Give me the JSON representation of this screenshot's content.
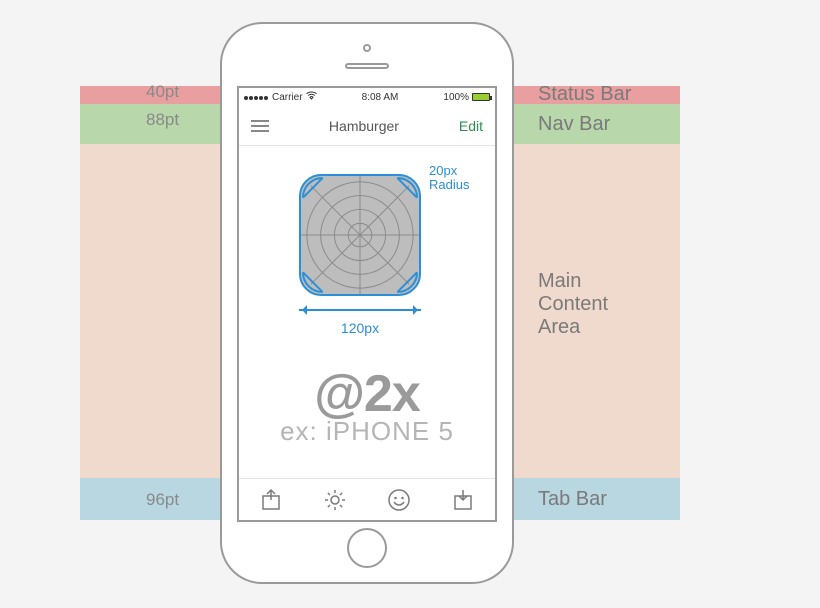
{
  "annotations": {
    "statusBarPt": "40pt",
    "navBarPt": "88pt",
    "tabBarPt": "96pt"
  },
  "bands": {
    "status": "Status Bar",
    "nav": "Nav Bar",
    "main": "Main\nContent\nArea",
    "tab": "Tab Bar"
  },
  "statusBar": {
    "carrier": "Carrier",
    "wifiIcon": "wifi-icon",
    "time": "8:08 AM",
    "batteryPct": "100%"
  },
  "navBar": {
    "menuIcon": "hamburger-icon",
    "title": "Hamburger",
    "edit": "Edit"
  },
  "iconSpecs": {
    "radiusLabel": "20px\nRadius",
    "widthLabel": "120px"
  },
  "resolution": {
    "scale": "@2x",
    "example": "ex: iPHONE 5"
  },
  "tabIcons": [
    "share-icon",
    "gear-icon",
    "smile-icon",
    "reply-icon"
  ]
}
